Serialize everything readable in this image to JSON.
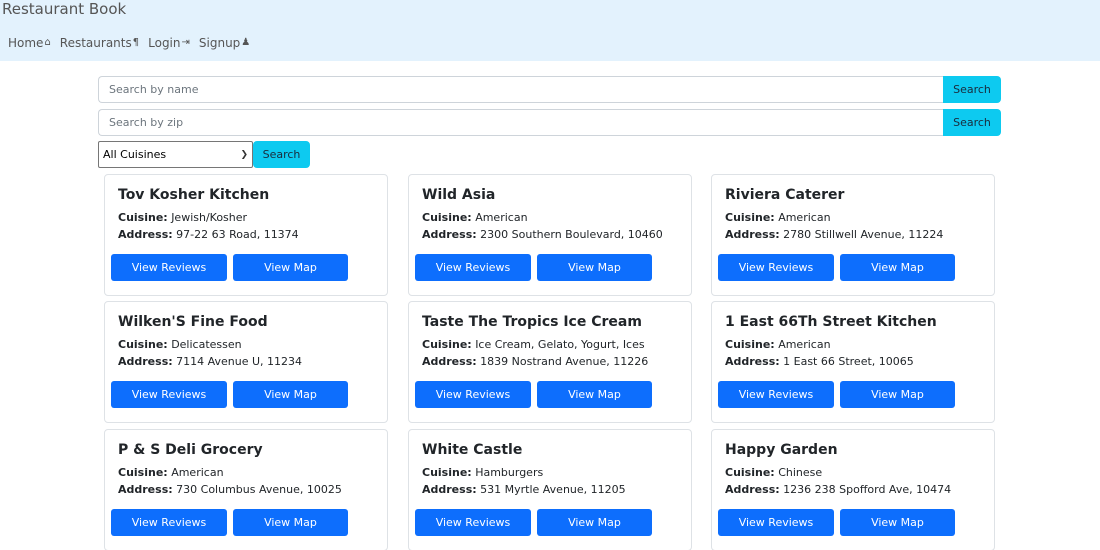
{
  "app": {
    "title": "Restaurant Book"
  },
  "nav": [
    {
      "label": "Home",
      "icon": "home-icon",
      "glyph": "⌂"
    },
    {
      "label": "Restaurants",
      "icon": "restaurant-icon",
      "glyph": "¶"
    },
    {
      "label": "Login",
      "icon": "login-icon",
      "glyph": "⇥"
    },
    {
      "label": "Signup",
      "icon": "signup-icon",
      "glyph": "♟"
    }
  ],
  "search": {
    "name_placeholder": "Search by name",
    "zip_placeholder": "Search by zip",
    "button_label": "Search"
  },
  "filter": {
    "selected": "All Cuisines",
    "button_label": "Search"
  },
  "labels": {
    "cuisine": "Cuisine:",
    "address": "Address:"
  },
  "buttons": {
    "reviews": "View Reviews",
    "map": "View Map"
  },
  "restaurants": [
    {
      "name": "Tov Kosher Kitchen",
      "cuisine": "Jewish/Kosher",
      "address": "97-22 63 Road, 11374"
    },
    {
      "name": "Wild Asia",
      "cuisine": "American",
      "address": "2300 Southern Boulevard, 10460"
    },
    {
      "name": "Riviera Caterer",
      "cuisine": "American",
      "address": "2780 Stillwell Avenue, 11224"
    },
    {
      "name": "Wilken'S Fine Food",
      "cuisine": "Delicatessen",
      "address": "7114 Avenue U, 11234"
    },
    {
      "name": "Taste The Tropics Ice Cream",
      "cuisine": "Ice Cream, Gelato, Yogurt, Ices",
      "address": "1839 Nostrand Avenue, 11226"
    },
    {
      "name": "1 East 66Th Street Kitchen",
      "cuisine": "American",
      "address": "1 East 66 Street, 10065"
    },
    {
      "name": "P & S Deli Grocery",
      "cuisine": "American",
      "address": "730 Columbus Avenue, 10025"
    },
    {
      "name": "White Castle",
      "cuisine": "Hamburgers",
      "address": "531 Myrtle Avenue, 11205"
    },
    {
      "name": "Happy Garden",
      "cuisine": "Chinese",
      "address": "1236 238 Spofford Ave, 10474"
    }
  ]
}
